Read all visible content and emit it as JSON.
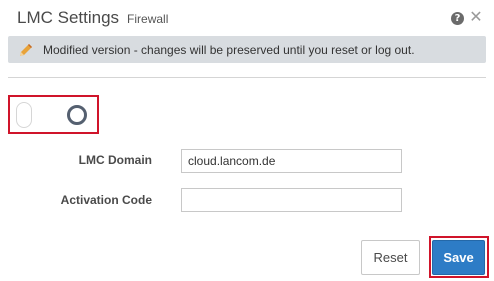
{
  "header": {
    "title": "LMC Settings",
    "subtitle": "Firewall",
    "help_icon": "question-circle-icon",
    "help_glyph": "?",
    "close_icon": "close-icon",
    "close_glyph": "✕"
  },
  "notice": {
    "icon": "pencil-icon",
    "text": "Modified version - changes will be preserved until you reset or log out.",
    "background_color": "#d8dce0"
  },
  "toggle": {
    "state": "off"
  },
  "form": {
    "domain_label": "LMC Domain",
    "domain_value": "cloud.lancom.de",
    "code_label": "Activation Code",
    "code_value": ""
  },
  "actions": {
    "reset_label": "Reset",
    "save_label": "Save",
    "save_color": "#2d7cc6",
    "highlight_color": "#d0142a"
  }
}
